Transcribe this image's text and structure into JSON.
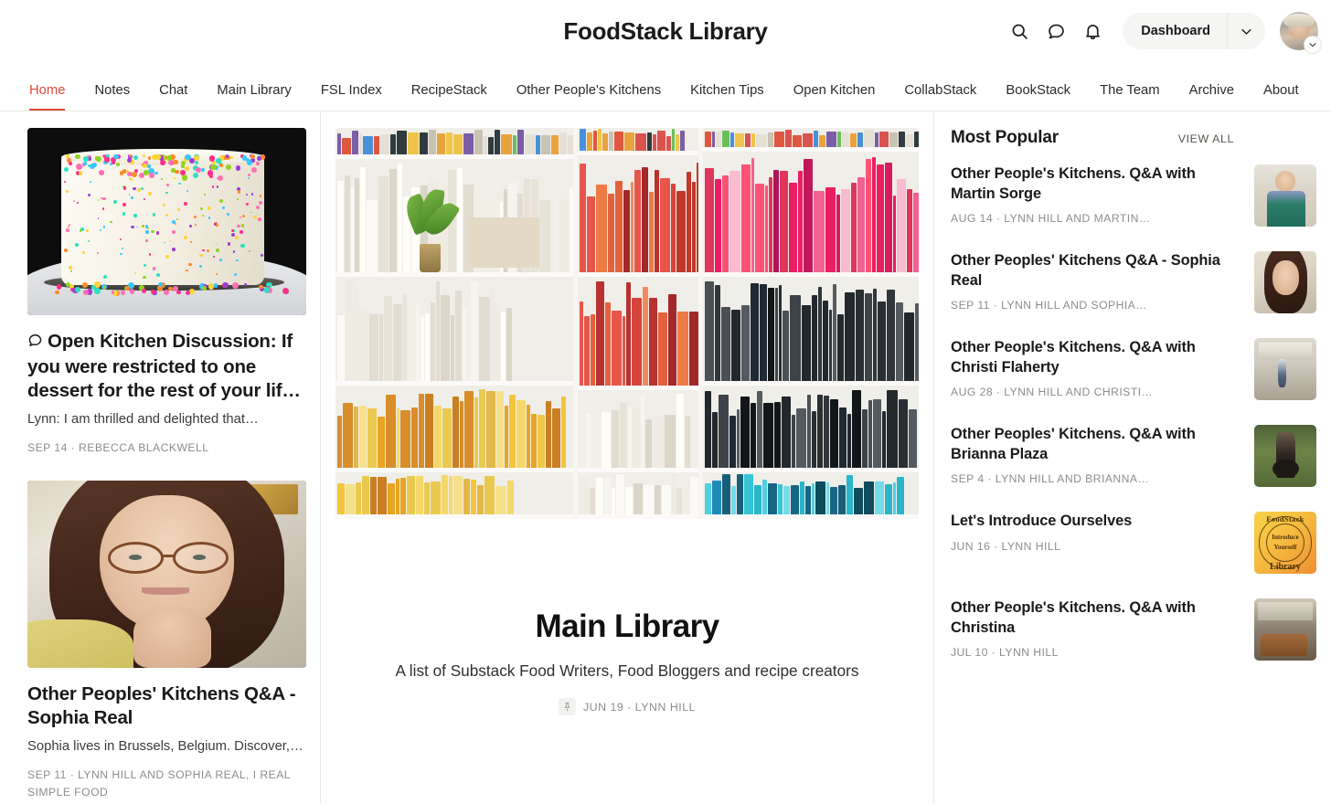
{
  "header": {
    "publication_title": "FoodStack Library",
    "search_icon": "search-icon",
    "chat_icon": "chat-bubble-icon",
    "notifications_icon": "bell-icon",
    "dashboard_label": "Dashboard",
    "dashboard_caret_icon": "chevron-down-icon",
    "avatar_caret_icon": "chevron-down-icon"
  },
  "nav": {
    "items": [
      {
        "label": "Home",
        "active": true
      },
      {
        "label": "Notes",
        "active": false
      },
      {
        "label": "Chat",
        "active": false
      },
      {
        "label": "Main Library",
        "active": false
      },
      {
        "label": "FSL Index",
        "active": false
      },
      {
        "label": "RecipeStack",
        "active": false
      },
      {
        "label": "Other People's Kitchens",
        "active": false
      },
      {
        "label": "Kitchen Tips",
        "active": false
      },
      {
        "label": "Open Kitchen",
        "active": false
      },
      {
        "label": "CollabStack",
        "active": false
      },
      {
        "label": "BookStack",
        "active": false
      },
      {
        "label": "The Team",
        "active": false
      },
      {
        "label": "Archive",
        "active": false
      },
      {
        "label": "About",
        "active": false
      }
    ],
    "active_color": "#e2483d"
  },
  "left_column": {
    "cards": [
      {
        "image_name": "sprinkle-cake-photo",
        "comment_icon": "comment-bubble-icon",
        "title": "Open Kitchen Discussion: If you were restricted to one dessert for the rest of your lif…",
        "subtitle": "Lynn: I am thrilled and delighted that…",
        "meta": "SEP 14 · REBECCA BLACKWELL"
      },
      {
        "image_name": "sophia-real-portrait-photo",
        "title": "Other Peoples' Kitchens Q&A - Sophia Real",
        "subtitle": "Sophia lives in Brussels, Belgium. Discover,…",
        "meta": "SEP 11 · LYNN HILL AND SOPHIA REAL, I REAL SIMPLE FOOD"
      }
    ]
  },
  "center_column": {
    "hero_image_name": "cookbook-bookshelf-photo",
    "title": "Main Library",
    "subtitle": "A list of Substack Food Writers, Food Bloggers and recipe creators",
    "pin_icon": "pin-icon",
    "meta": "JUN 19 · LYNN HILL"
  },
  "right_column": {
    "section_title": "Most Popular",
    "view_all_label": "VIEW ALL",
    "items": [
      {
        "title": "Other People's Kitchens. Q&A with Martin Sorge",
        "meta": "AUG 14 · LYNN HILL AND MARTIN…",
        "thumb_name": "martin-sorge-thumbnail",
        "thumb_class": "th-martin"
      },
      {
        "title": "Other Peoples' Kitchens Q&A - Sophia Real",
        "meta": "SEP 11 · LYNN HILL AND SOPHIA…",
        "thumb_name": "sophia-real-thumbnail",
        "thumb_class": "th-sophia"
      },
      {
        "title": "Other People's Kitchens. Q&A with Christi Flaherty",
        "meta": "AUG 28 · LYNN HILL AND CHRISTI…",
        "thumb_name": "christi-flaherty-thumbnail",
        "thumb_class": "th-christi"
      },
      {
        "title": "Other Peoples' Kitchens. Q&A with Brianna Plaza",
        "meta": "SEP 4 · LYNN HILL AND BRIANNA…",
        "thumb_name": "brianna-plaza-thumbnail",
        "thumb_class": "th-brianna"
      },
      {
        "title": "Let's Introduce Ourselves",
        "meta": "JUN 16 · LYNN HILL",
        "thumb_name": "foodstack-library-badge-thumbnail",
        "thumb_class": "th-badge",
        "badge_text": {
          "t1": "FoodStack",
          "t2": "Introduce",
          "t3": "Yourself",
          "t4": "Library"
        }
      },
      {
        "title": "Other People's Kitchens. Q&A with Christina",
        "meta": "JUL 10 · LYNN HILL",
        "thumb_name": "christina-kitchen-thumbnail",
        "thumb_class": "th-christina"
      }
    ]
  }
}
